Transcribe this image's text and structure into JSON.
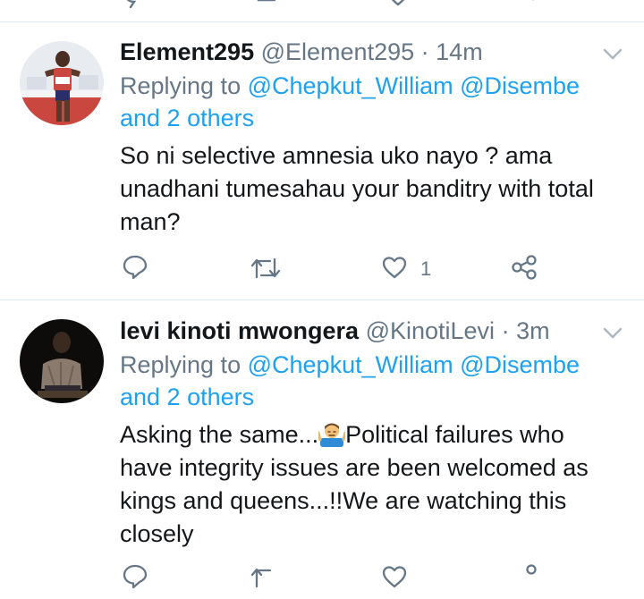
{
  "colors": {
    "accent": "#1da1f2",
    "secondary": "#657786",
    "text": "#14171a",
    "divider": "#e1e8ed"
  },
  "tweets": [
    {
      "name": "Element295",
      "handle": "@Element295",
      "separator": "·",
      "time": "14m",
      "replying_prefix": "Replying to",
      "mention1": "@Chepkut_William",
      "mention2": "@Disembe",
      "others": "and 2 others",
      "body": "So ni selective amnesia uko nayo ? ama unadhani tumesahau your banditry with total man?",
      "like_count": "1",
      "icons": [
        "reply-icon",
        "retweet-icon",
        "like-icon",
        "share-icon"
      ]
    },
    {
      "name": "levi kinoti mwongera",
      "handle": "@KinotiLevi",
      "separator": "·",
      "time": "3m",
      "replying_prefix": "Replying to",
      "mention1": "@Chepkut_William",
      "mention2": "@Disembe",
      "others": "and 2 others",
      "body_part1": "Asking the same...",
      "emoji": "man-shrugging-emoji",
      "body_part2": "Political failures who have integrity issues are been welcomed as kings and queens...!!We are watching this closely"
    }
  ]
}
